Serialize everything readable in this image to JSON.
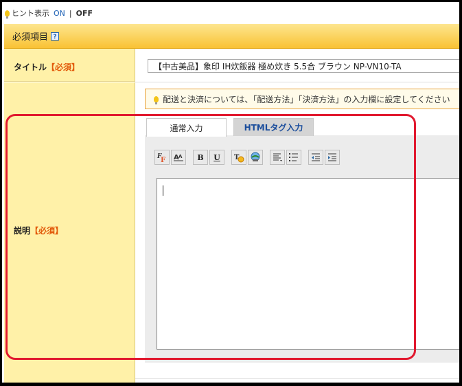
{
  "hint_bar": {
    "label": "ヒント表示",
    "on": "ON",
    "separator": "|",
    "off": "OFF"
  },
  "section": {
    "title": "必須項目",
    "help": "?"
  },
  "title_row": {
    "label": "タイトル",
    "required": "【必須】",
    "value": "【中古美品】象印 IH炊飯器 極め炊き 5.5合 ブラウン NP-VN10-TA"
  },
  "desc_row": {
    "label": "説明",
    "required": "【必須】",
    "hint": "配送と決済については、「配送方法」「決済方法」の入力欄に設定してください",
    "tabs": [
      {
        "label": "通常入力",
        "active": true
      },
      {
        "label": "HTMLタグ入力",
        "active": false
      }
    ],
    "toolbar": [
      "font-face-icon",
      "font-size-icon",
      "bold-icon",
      "underline-icon",
      "text-color-icon",
      "link-icon",
      "align-icon",
      "list-icon",
      "outdent-icon",
      "indent-icon"
    ],
    "toolbar_labels": {
      "bold": "B",
      "underline": "U"
    }
  },
  "colors": {
    "highlight": "#e1192f",
    "header": "#f9c234",
    "label_bg": "#fff1a8",
    "required": "#e25a0b"
  }
}
